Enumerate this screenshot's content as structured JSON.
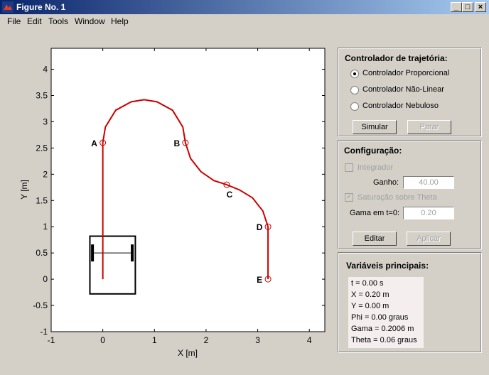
{
  "window": {
    "title": "Figure No. 1",
    "controls": [
      "_",
      "□",
      "×"
    ]
  },
  "menu": [
    "File",
    "Edit",
    "Tools",
    "Window",
    "Help"
  ],
  "chart_data": {
    "type": "line",
    "xlabel": "X [m]",
    "ylabel": "Y [m]",
    "xlim": [
      -1,
      4.3
    ],
    "ylim": [
      -1,
      4.4
    ],
    "xticks": [
      "-1",
      "0",
      "1",
      "2",
      "3",
      "4"
    ],
    "yticks": [
      "-1",
      "-0.5",
      "0",
      "0.5",
      "1",
      "1.5",
      "2",
      "2.5",
      "3",
      "3.5",
      "4"
    ],
    "trajectory_color": "#cc0000",
    "trajectory": [
      [
        0,
        0
      ],
      [
        0,
        2.6
      ],
      [
        0.05,
        2.9
      ],
      [
        0.25,
        3.22
      ],
      [
        0.55,
        3.38
      ],
      [
        0.8,
        3.42
      ],
      [
        1.05,
        3.38
      ],
      [
        1.35,
        3.22
      ],
      [
        1.55,
        2.9
      ],
      [
        1.6,
        2.6
      ],
      [
        1.7,
        2.3
      ],
      [
        1.9,
        2.05
      ],
      [
        2.15,
        1.88
      ],
      [
        2.4,
        1.8
      ],
      [
        2.65,
        1.7
      ],
      [
        2.9,
        1.55
      ],
      [
        3.1,
        1.3
      ],
      [
        3.2,
        1.0
      ],
      [
        3.2,
        0
      ]
    ],
    "waypoints": [
      {
        "label": "A",
        "x": 0,
        "y": 2.6
      },
      {
        "label": "B",
        "x": 1.6,
        "y": 2.6
      },
      {
        "label": "C",
        "x": 2.4,
        "y": 1.8
      },
      {
        "label": "D",
        "x": 3.2,
        "y": 1.0
      },
      {
        "label": "E",
        "x": 3.2,
        "y": 0
      }
    ],
    "vehicle": {
      "x_range": [
        -0.25,
        0.63
      ],
      "y_range": [
        -0.28,
        0.82
      ],
      "axle_y": 0.5,
      "wheel_x": [
        -0.2,
        0.57
      ]
    },
    "grid": false,
    "legend": "none"
  },
  "controller": {
    "title": "Controlador de trajetória:",
    "options": [
      {
        "label": "Controlador Proporcional",
        "selected": true
      },
      {
        "label": "Controlador Não-Linear",
        "selected": false
      },
      {
        "label": "Controlador Nebuloso",
        "selected": false
      }
    ],
    "simulate_label": "Simular",
    "stop_label": "Parar"
  },
  "config": {
    "title": "Configuração:",
    "integrator_label": "Integrador",
    "gain_label": "Ganho:",
    "gain_value": "40.00",
    "saturation_label": "Saturação sobre Theta",
    "gamma_label": "Gama em t=0:",
    "gamma_value": "0.20",
    "edit_label": "Editar",
    "apply_label": "Aplicar"
  },
  "vars": {
    "title": "Variáveis principais:",
    "lines": [
      "t = 0.00 s",
      "X = 0.20 m",
      "Y = 0.00 m",
      "Phi = 0.00 graus",
      "Gama = 0.2006 m",
      "Theta = 0.06 graus"
    ]
  }
}
